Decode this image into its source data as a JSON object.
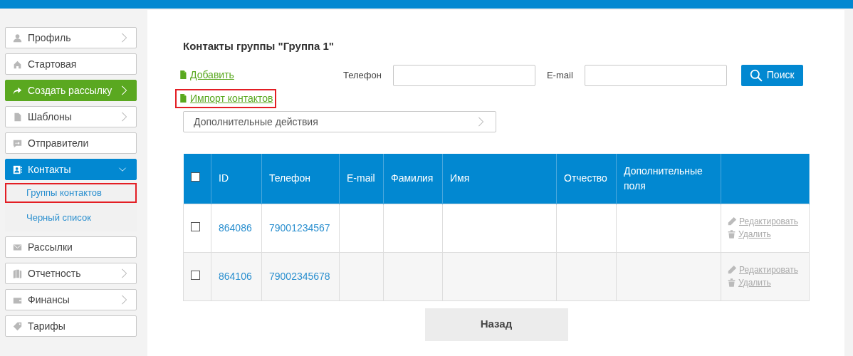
{
  "sidebar": {
    "items": [
      {
        "label": "Профиль",
        "expandable": true,
        "kind": "normal"
      },
      {
        "label": "Стартовая",
        "expandable": false,
        "kind": "normal"
      },
      {
        "label": "Создать рассылку",
        "expandable": true,
        "kind": "accent"
      },
      {
        "label": "Шаблоны",
        "expandable": true,
        "kind": "normal"
      },
      {
        "label": "Отправители",
        "expandable": false,
        "kind": "normal"
      },
      {
        "label": "Контакты",
        "expandable": true,
        "expanded": true,
        "kind": "active",
        "children": [
          {
            "label": "Группы контактов",
            "highlighted": true
          },
          {
            "label": "Черный список",
            "highlighted": false
          }
        ]
      },
      {
        "label": "Рассылки",
        "expandable": false,
        "kind": "normal"
      },
      {
        "label": "Отчетность",
        "expandable": true,
        "kind": "normal"
      },
      {
        "label": "Финансы",
        "expandable": true,
        "kind": "normal"
      },
      {
        "label": "Тарифы",
        "expandable": false,
        "kind": "normal"
      }
    ]
  },
  "page": {
    "title": "Контакты группы \"Группа 1\"",
    "links": [
      {
        "label": "Добавить",
        "highlighted": false
      },
      {
        "label": "Импорт контактов",
        "highlighted": true
      }
    ],
    "filters": [
      {
        "label": "Телефон"
      },
      {
        "label": "E-mail"
      }
    ],
    "search_button": "Поиск",
    "actions_dropdown": "Дополнительные действия",
    "table": {
      "select_all_checked": false,
      "columns": [
        "ID",
        "Телефон",
        "E-mail",
        "Фамилия",
        "Имя",
        "Отчество",
        "Дополнительные поля"
      ],
      "rows": [
        {
          "checked": false,
          "cells": [
            "864086",
            "79001234567",
            "",
            "",
            "",
            "",
            ""
          ],
          "actions": [
            "Редактировать",
            "Удалить"
          ]
        },
        {
          "checked": false,
          "cells": [
            "864106",
            "79002345678",
            "",
            "",
            "",
            "",
            ""
          ],
          "actions": [
            "Редактировать",
            "Удалить"
          ]
        }
      ]
    },
    "back_button": "Назад"
  }
}
